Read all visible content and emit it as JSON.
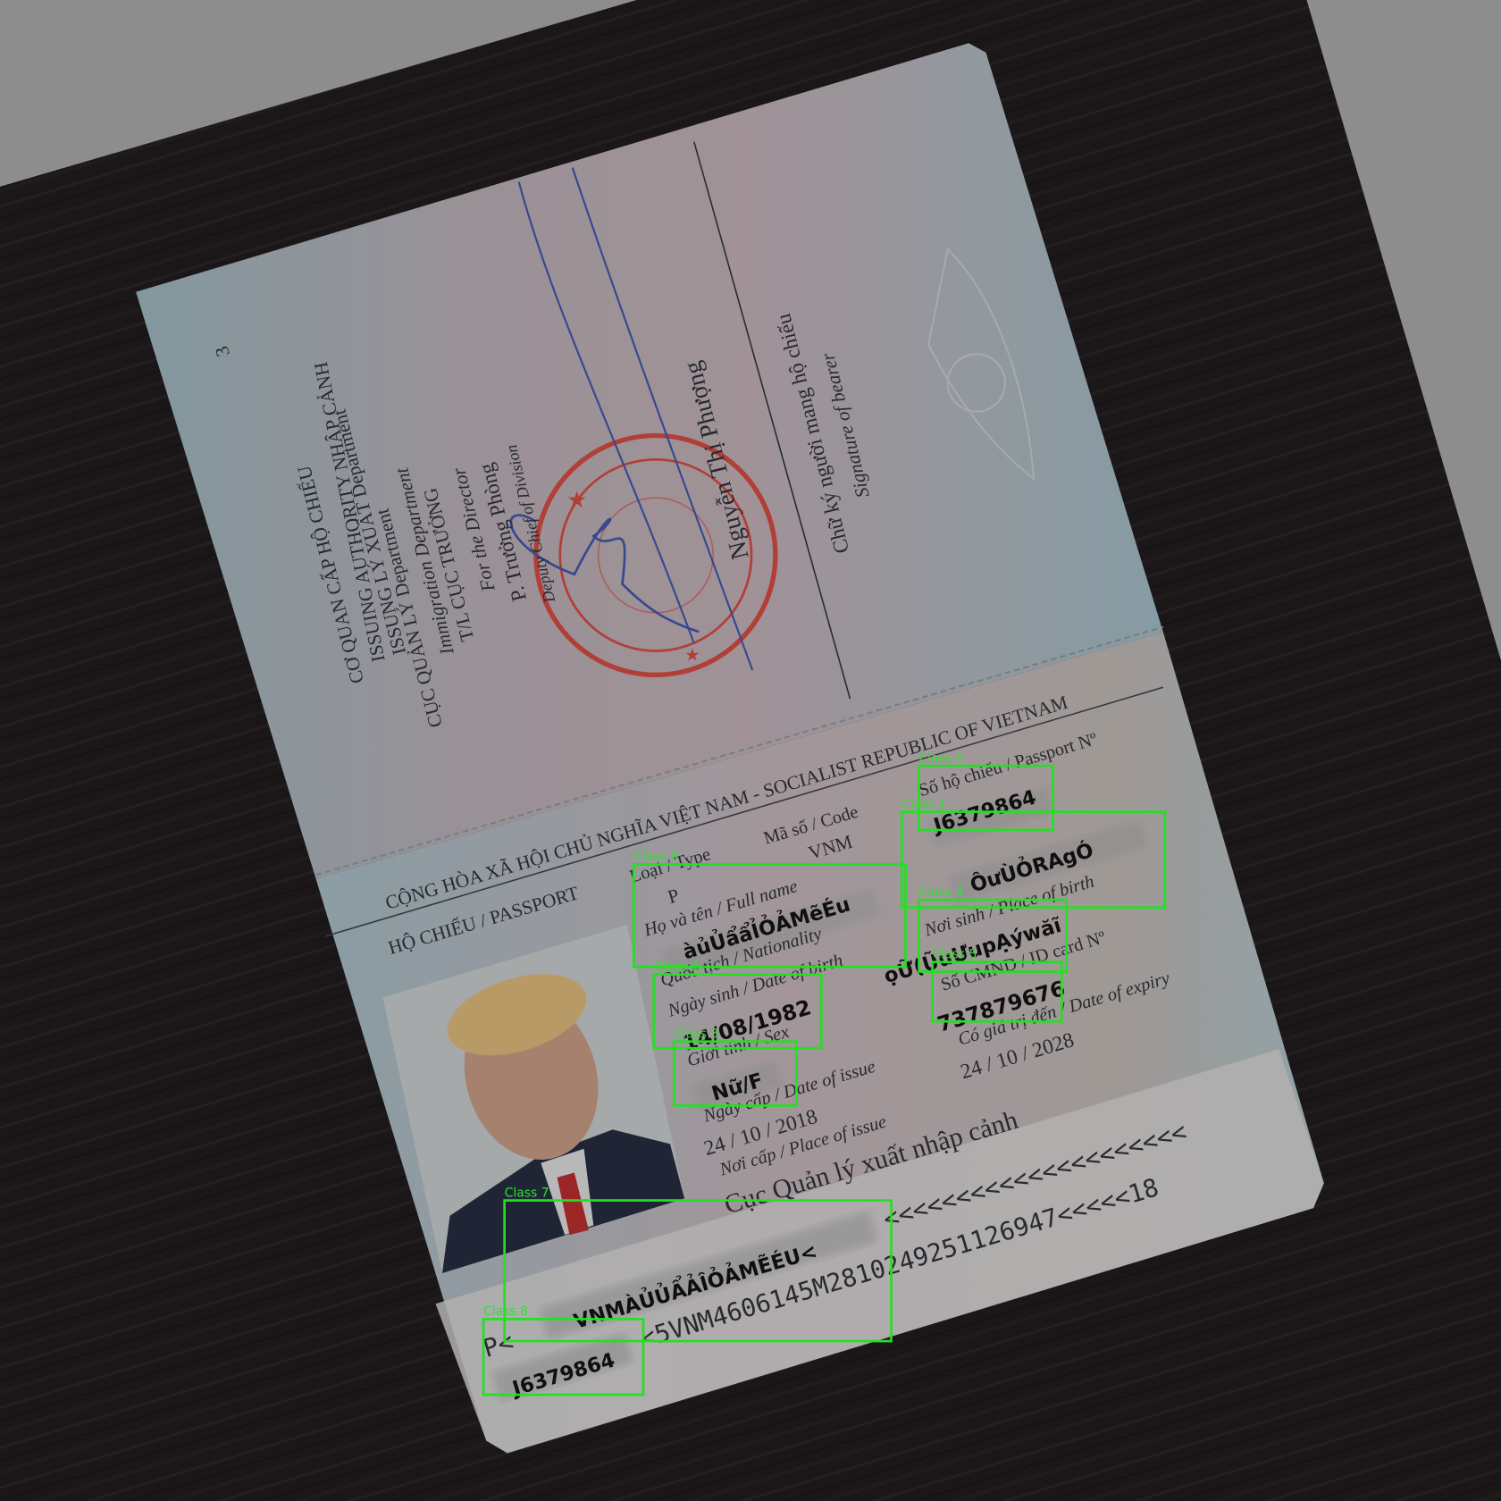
{
  "page_number": "3",
  "issuing_page": {
    "lines": [
      "CƠ QUAN CẤP HỘ CHIẾU",
      "ISSUING AUTHORITY NHẬP CẢNH",
      "ISSUNG LÝ XUẤT Department",
      "CỤC QUẢN LÝ Department",
      "Immigration Department",
      "T/L CỤC TRƯỞNG",
      "For the Director",
      "P. Trưởng Phòng",
      "Deputy Chief of Division"
    ],
    "signer_name": "Nguyễn Thị Phượng",
    "bearer_signature_vi": "Chữ ký người mang hộ chiếu",
    "bearer_signature_en": "Signature of bearer"
  },
  "data_page": {
    "header": "CỘNG HÒA XÃ HỘI CHỦ NGHĨA VIỆT NAM - SOCIALIST REPUBLIC OF VIETNAM",
    "doc_title": "HỘ CHIẾU / PASSPORT",
    "type_label": "Loại / Type",
    "type": "P",
    "code_label": "Mã số / Code",
    "code": "VNM",
    "passport_no_label": "Số hộ chiếu / Passport Nº",
    "passport_no": "J6379864",
    "full_name_label": "Họ và tên / Full name",
    "full_name": "àủỦẩẩỈỎẢMẽÉu",
    "nationality_label": "Quốc tịch / Nationality",
    "nationality": "ÔưÙỎRAgÓ",
    "place_of_birth_label": "Nơi sinh / Place of birth",
    "place_of_birth": "ọỮ(ŨuƯupẠýwăĩ",
    "dob_label": "Ngày sinh / Date of birth",
    "dob": "14/08/1982",
    "id_card_label": "Số CMND / ID card Nº",
    "id_card": "737879676",
    "sex_label": "Giới tính / Sex",
    "sex": "Nữ/F",
    "expiry_label": "Có giá trị đến / Date of expiry",
    "expiry": "24 / 10 / 2028",
    "issue_date_label": "Ngày cấp / Date of issue",
    "issue_date": "24 / 10 / 2018",
    "issue_place_label": "Nơi cấp / Place of issue",
    "issue_place": "Cục Quản lý xuất nhập cảnh"
  },
  "mrz": {
    "line1_prefix": "P<",
    "line1_name": "VNMÀỦỦẨẢÎỎẢMẼÉU<",
    "line1_filler": "<<<<<<<<<<<<<<<<<<<<<",
    "line2_number": "J6379864",
    "line2_rest": "<5VNM4606145M2810249251126947<<<<<18"
  },
  "detections": [
    {
      "label": "Class 0"
    },
    {
      "label": "Class 1"
    },
    {
      "label": "Class 2"
    },
    {
      "label": "Class 3"
    },
    {
      "label": "Class 4"
    },
    {
      "label": "Class 5"
    },
    {
      "label": "Class 6"
    },
    {
      "label": "Class 7"
    },
    {
      "label": "Class 8"
    }
  ],
  "colors": {
    "detection_box": "#22e022",
    "stamp": "#c0443c",
    "signature_ink": "#3b4f9c",
    "background": "#9a9a9a"
  }
}
